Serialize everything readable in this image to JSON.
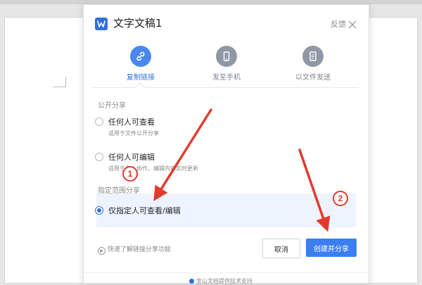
{
  "dialog": {
    "title": "文字文稿1",
    "feedback_label": "反馈"
  },
  "tabs": [
    {
      "label": "复制链接",
      "icon": "link-icon",
      "active": true
    },
    {
      "label": "发至手机",
      "icon": "phone-icon",
      "active": false
    },
    {
      "label": "以文件发送",
      "icon": "file-icon",
      "active": false
    }
  ],
  "public_share": {
    "section_label": "公开分享",
    "options": [
      {
        "title": "任何人可查看",
        "desc": "适用于文件公开分享"
      },
      {
        "title": "任何人可编辑",
        "desc": "适用于多人协作、编辑内容实时更新"
      }
    ]
  },
  "specified_share": {
    "section_label": "指定范围分享",
    "option": {
      "title": "仅指定人可查看/编辑",
      "selected": true
    }
  },
  "footer": {
    "help_link": "快速了解链接分享功能",
    "cancel_label": "取消",
    "create_label": "创建并分享",
    "provider_text": "金山文档提供技术支持"
  },
  "annotations": [
    {
      "number": "1"
    },
    {
      "number": "2"
    }
  ],
  "colors": {
    "accent": "#3a7ff2",
    "icon_active": "#4a88f0",
    "icon_inactive": "#8f99a6",
    "arrow_red": "#e23b2e"
  }
}
